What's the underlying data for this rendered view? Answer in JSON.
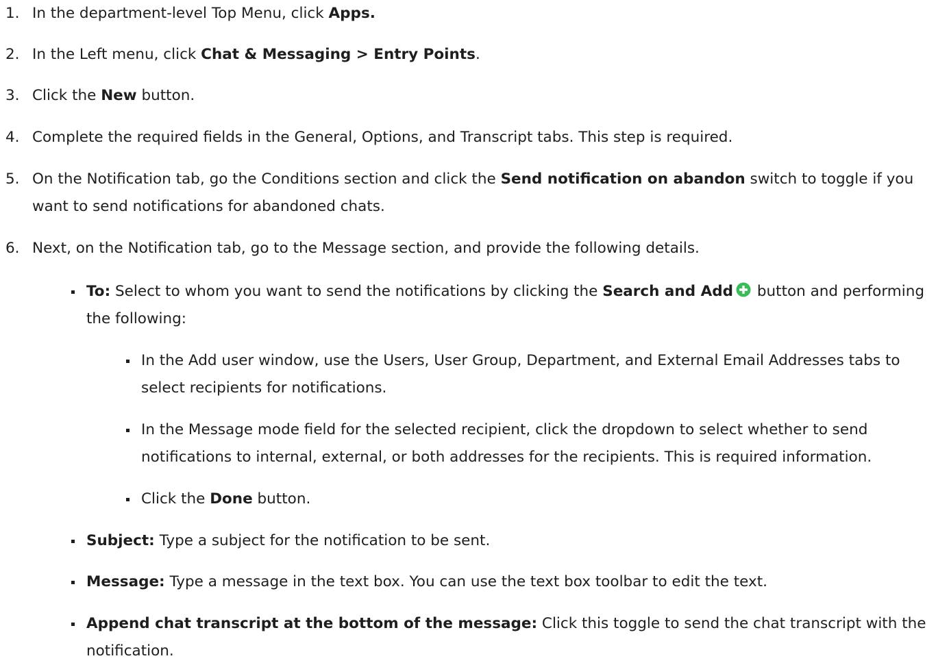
{
  "steps": [
    {
      "num": "1.",
      "pre": " In the department-level Top Menu, click ",
      "bold": "Apps.",
      "post": ""
    },
    {
      "num": "2.",
      "pre": "In the Left menu, click ",
      "bold": "Chat & Messaging > Entry Points",
      "post": "."
    },
    {
      "num": "3.",
      "pre": "Click the ",
      "bold": "New",
      "post": " button."
    },
    {
      "num": "4.",
      "text": "Complete the required fields in the General, Options, and Transcript tabs. This step is required."
    },
    {
      "num": "5.",
      "pre": "On the Notification tab, go the Conditions section and click the ",
      "bold": "Send notification on abandon",
      "post": " switch to toggle if you want to send notifications for abandoned chats."
    },
    {
      "num": "6.",
      "text": "Next, on the Notification tab, go to the Message section, and provide the following details."
    }
  ],
  "to_item": {
    "bold": "To:",
    "pre": " Select to whom you want to send the notifications by clicking the ",
    "bold2": "Search and Add",
    "post": " button and performing the following:",
    "icon": "plus-circle-icon",
    "icon_color": "#3dbb5a"
  },
  "sub_items": [
    {
      "text": "In the Add user window, use the Users, User Group, Department, and External Email Addresses tabs to select recipients for notifications."
    },
    {
      "text": "In the Message mode field for the selected recipient, click the dropdown to select whether to send notifications to internal, external, or both addresses for the recipients. This is required information."
    },
    {
      "pre": "Click the ",
      "bold": "Done",
      "post": " button."
    }
  ],
  "items": [
    {
      "bold": "Subject:",
      "post": " Type a subject for the notification to be sent."
    },
    {
      "bold": "Message:",
      "post": " Type a message in the text box. You can use the text box toolbar to edit the text."
    },
    {
      "bold": "Append chat transcript at the bottom of the message:",
      "post": " Click this toggle to send the chat transcript with the notification."
    }
  ]
}
